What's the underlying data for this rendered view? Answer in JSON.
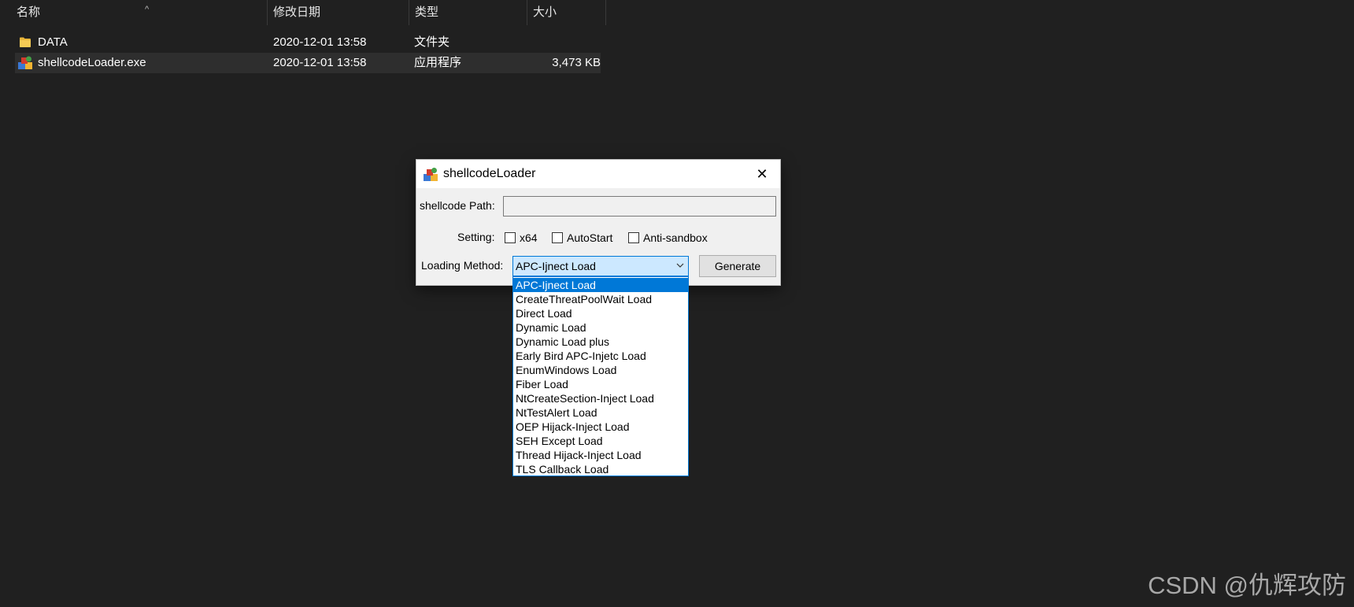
{
  "explorer": {
    "columns": {
      "name": "名称",
      "modified": "修改日期",
      "type": "类型",
      "size": "大小"
    },
    "sort_indicator": "^",
    "files": [
      {
        "name": "DATA",
        "modified": "2020-12-01 13:58",
        "type": "文件夹",
        "size": "",
        "icon": "folder-icon"
      },
      {
        "name": "shellcodeLoader.exe",
        "modified": "2020-12-01 13:58",
        "type": "应用程序",
        "size": "3,473 KB",
        "icon": "exe-icon"
      }
    ]
  },
  "dialog": {
    "title": "shellcodeLoader",
    "close_glyph": "✕",
    "shellcode_path_label": "shellcode Path:",
    "shellcode_path_value": "",
    "setting_label": "Setting:",
    "checkboxes": [
      {
        "label": "x64",
        "checked": false
      },
      {
        "label": "AutoStart",
        "checked": false
      },
      {
        "label": "Anti-sandbox",
        "checked": false
      }
    ],
    "loading_method_label": "Loading Method:",
    "loading_method_value": "APC-Ijnect Load",
    "generate_label": "Generate",
    "selected_index": 0,
    "loading_methods": [
      "APC-Ijnect Load",
      "CreateThreatPoolWait Load",
      "Direct Load",
      "Dynamic Load",
      "Dynamic Load plus",
      "Early Bird APC-Injetc Load",
      "EnumWindows Load",
      "Fiber Load",
      "NtCreateSection-Inject Load",
      "NtTestAlert Load",
      "OEP Hijack-Inject Load",
      "SEH Except Load",
      "Thread Hijack-Inject Load",
      "TLS Callback Load"
    ]
  },
  "colors": {
    "background": "#202020",
    "selection_blue": "#0078d7",
    "combo_highlight": "#cce8ff"
  },
  "watermark": "CSDN @仇辉攻防"
}
